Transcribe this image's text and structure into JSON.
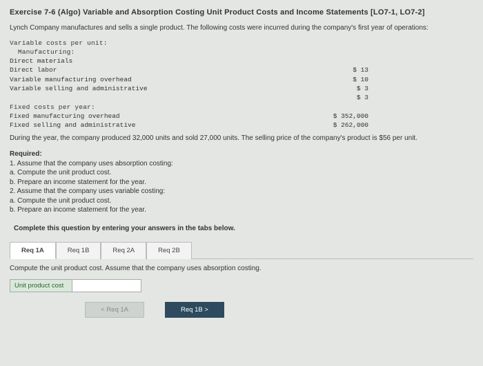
{
  "title": "Exercise 7-6 (Algo) Variable and Absorption Costing Unit Product Costs and Income Statements [LO7-1, LO7-2]",
  "intro": "Lynch Company manufactures and sells a single product. The following costs were incurred during the company's first year of operations:",
  "cost_headers": {
    "var_per_unit": "Variable costs per unit:",
    "manufacturing": "Manufacturing:",
    "fixed_per_year": "Fixed costs per year:"
  },
  "costs": [
    {
      "label": "    Direct materials",
      "val": ""
    },
    {
      "label": "    Direct labor",
      "val": "$ 13"
    },
    {
      "label": "    Variable manufacturing overhead",
      "val": "$ 10"
    },
    {
      "label": "  Variable selling and administrative",
      "val": "$ 3"
    },
    {
      "label": "",
      "val": "$ 3"
    }
  ],
  "fixed": [
    {
      "label": "  Fixed manufacturing overhead",
      "val": "$ 352,000"
    },
    {
      "label": "  Fixed selling and administrative",
      "val": "$ 262,000"
    }
  ],
  "during": "During the year, the company produced 32,000 units and sold 27,000 units. The selling price of the company's product is $56 per unit.",
  "req_head": "Required:",
  "req": [
    "1. Assume that the company uses absorption costing:",
    "a. Compute the unit product cost.",
    "b. Prepare an income statement for the year.",
    "2. Assume that the company uses variable costing:",
    "a. Compute the unit product cost.",
    "b. Prepare an income statement for the year."
  ],
  "complete": "Complete this question by entering your answers in the tabs below.",
  "tabs": {
    "t1a": "Req 1A",
    "t1b": "Req 1B",
    "t2a": "Req 2A",
    "t2b": "Req 2B"
  },
  "tabdesc": "Compute the unit product cost. Assume that the company uses absorption costing.",
  "answer_label": "Unit product cost",
  "nav": {
    "prev": "<  Req 1A",
    "next": "Req 1B  >"
  }
}
